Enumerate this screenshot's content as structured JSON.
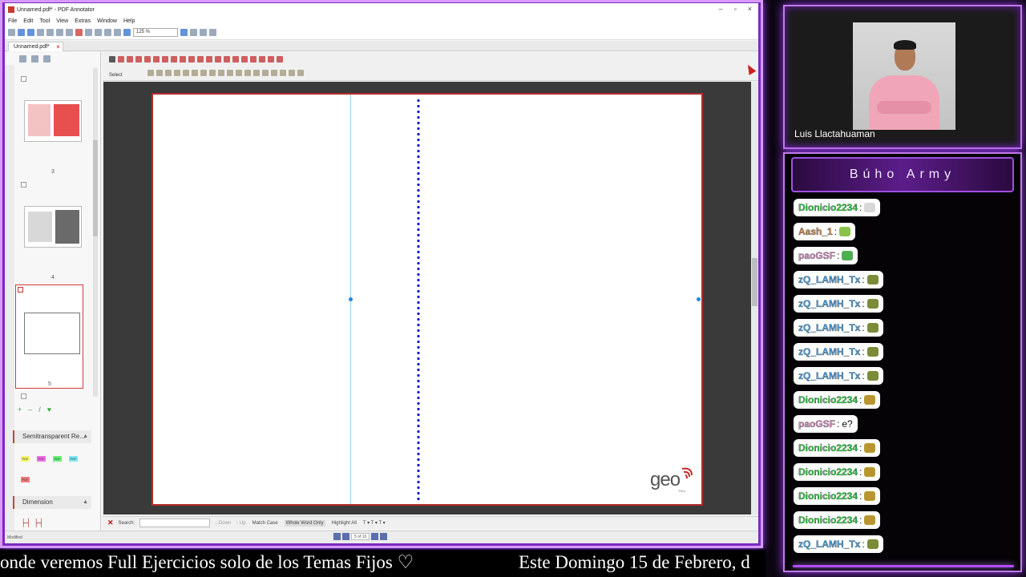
{
  "app": {
    "title": "Unnamed.pdf* - PDF Annotator",
    "menu": [
      "File",
      "Edit",
      "Tool",
      "View",
      "Extras",
      "Window",
      "Help"
    ],
    "zoom": "125 %",
    "doc_tab": "Unnamed.pdf*",
    "select_label": "Select",
    "thumbnail_numbers": [
      "3",
      "4",
      "5"
    ],
    "props": {
      "section1": "Semitransparent Re...",
      "section2": "Dimension",
      "swatches": [
        {
          "label": "PDF",
          "color": "#f5f56a"
        },
        {
          "label": "PDF",
          "color": "#f06ee8"
        },
        {
          "label": "PDF",
          "color": "#6cf07a"
        },
        {
          "label": "PDF",
          "color": "#7ee8f5"
        },
        {
          "label": "PDF",
          "color": "#f47a7a"
        }
      ]
    },
    "search": {
      "label": "Search:",
      "down": "Down",
      "up": "Up",
      "match_case": "Match Case",
      "whole_word": "Whole Word Only",
      "highlight": "Highlight All"
    },
    "status": {
      "left": "Modified",
      "page": "5 of 10"
    },
    "logo": {
      "text": "geo",
      "sub": "Perú"
    },
    "colors": {
      "page_border": "#b52a2a",
      "dotted_line": "#1010d0",
      "guide_line": "#9dd0f0"
    }
  },
  "webcam": {
    "name": "Luis Llactahuaman"
  },
  "chat": {
    "title": "Búho Army",
    "messages": [
      {
        "user": "Dionicio2234",
        "color": "#2ecc40",
        "text": "",
        "emote": "#d8d8d8"
      },
      {
        "user": "Aash_1",
        "color": "#c8894a",
        "text": "",
        "emote": "#8bc34a"
      },
      {
        "user": "paoGSF",
        "color": "#d48ec0",
        "text": "",
        "emote": "#4caf50"
      },
      {
        "user": "zQ_LAMH_Tx",
        "color": "#4aa3df",
        "text": "",
        "emote": "#7a8b3a"
      },
      {
        "user": "zQ_LAMH_Tx",
        "color": "#4aa3df",
        "text": "",
        "emote": "#7a8b3a"
      },
      {
        "user": "zQ_LAMH_Tx",
        "color": "#4aa3df",
        "text": "",
        "emote": "#7a8b3a"
      },
      {
        "user": "zQ_LAMH_Tx",
        "color": "#4aa3df",
        "text": "",
        "emote": "#7a8b3a"
      },
      {
        "user": "zQ_LAMH_Tx",
        "color": "#4aa3df",
        "text": "",
        "emote": "#7a8b3a"
      },
      {
        "user": "Dionicio2234",
        "color": "#2ecc40",
        "text": "",
        "emote": "#b8962e"
      },
      {
        "user": "paoGSF",
        "color": "#d48ec0",
        "text": "e?",
        "emote": ""
      },
      {
        "user": "Dionicio2234",
        "color": "#2ecc40",
        "text": "",
        "emote": "#b8962e"
      },
      {
        "user": "Dionicio2234",
        "color": "#2ecc40",
        "text": "",
        "emote": "#b8962e"
      },
      {
        "user": "Dionicio2234",
        "color": "#2ecc40",
        "text": "",
        "emote": "#b8962e"
      },
      {
        "user": "Dionicio2234",
        "color": "#2ecc40",
        "text": "",
        "emote": "#b8962e"
      },
      {
        "user": "zQ_LAMH_Tx",
        "color": "#4aa3df",
        "text": "",
        "emote": "#7a8b3a"
      }
    ]
  },
  "ticker": {
    "part1": "onde veremos Full Ejercicios solo de los Temas Fijos ♡",
    "part2": "Este Domingo 15 de Febrero, d"
  }
}
